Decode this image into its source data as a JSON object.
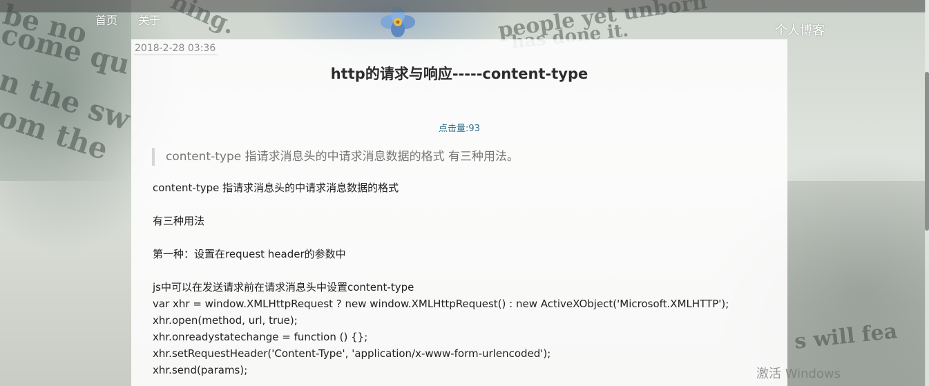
{
  "nav": {
    "home": "首页",
    "about": "关于"
  },
  "brand": "个人博客",
  "post": {
    "date": "2018-2-28 03:36",
    "title": "http的请求与响应-----content-type",
    "views_label": "点击量:",
    "views_count": "93",
    "summary": "content-type 指请求消息头的中请求消息数据的格式 有三种用法。",
    "lines": [
      "content-type 指请求消息头的中请求消息数据的格式",
      "",
      "有三种用法",
      "",
      "第一种：设置在request header的参数中",
      "",
      "js中可以在发送请求前在请求消息头中设置content-type",
      "var xhr = window.XMLHttpRequest ? new window.XMLHttpRequest() : new ActiveXObject('Microsoft.XMLHTTP');",
      "xhr.open(method, url, true);",
      "xhr.onreadystatechange = function () {};",
      "xhr.setRequestHeader('Content-Type', 'application/x-www-form-urlencoded');",
      "xhr.send(params);"
    ]
  },
  "watermark": "激活 Windows",
  "colors": {
    "link": "#2f6f8a",
    "title": "#2c2c2c",
    "quote_border": "#d6d6d6"
  }
}
